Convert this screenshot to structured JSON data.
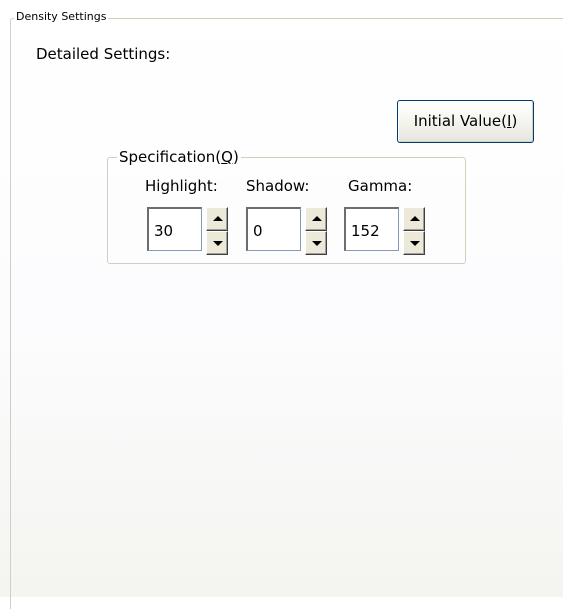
{
  "density_group": {
    "title": "Density Settings"
  },
  "detailed_label": "Detailed Settings:",
  "initial_value_button": {
    "label_prefix": "Initial Value(",
    "mnemonic": "I",
    "label_suffix": ")"
  },
  "specification_group": {
    "title_prefix": "Specification(",
    "mnemonic": "Q",
    "title_suffix": ")",
    "fields": [
      {
        "label": "Highlight:",
        "value": "30"
      },
      {
        "label": "Shadow:",
        "value": "0"
      },
      {
        "label": "Gamma:",
        "value": "152"
      }
    ]
  },
  "icons": {
    "spin_up": "triangle-up-icon",
    "spin_down": "triangle-down-icon"
  }
}
